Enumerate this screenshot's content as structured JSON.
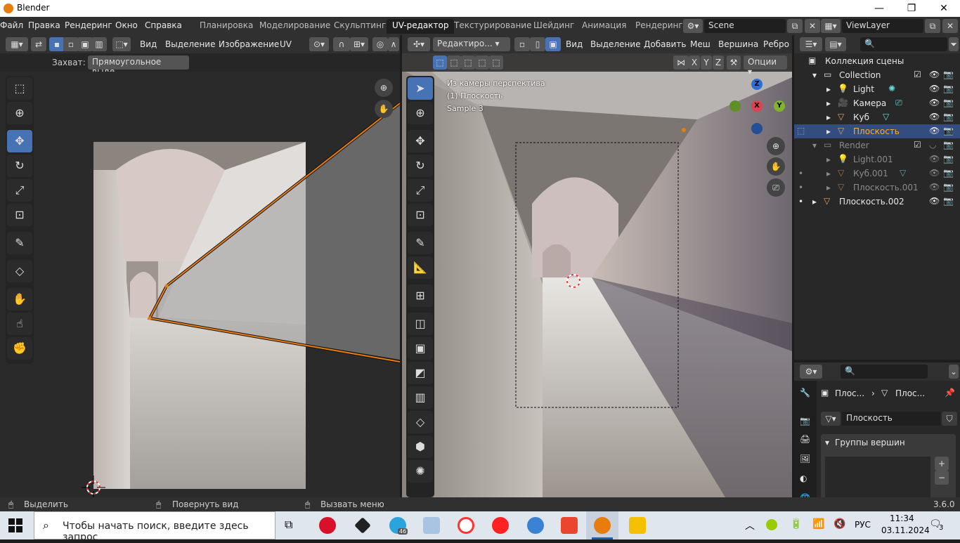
{
  "window": {
    "app_title": "Blender",
    "min": "—",
    "max": "❐",
    "close": "✕"
  },
  "menu": {
    "items": [
      "Файл",
      "Правка",
      "Рендеринг",
      "Окно",
      "Справка"
    ]
  },
  "workspaces": [
    "Планировка",
    "Моделирование",
    "Скульптинг",
    "UV-редактор",
    "Текстурирование",
    "Шейдинг",
    "Анимация",
    "Рендеринг"
  ],
  "active_workspace": "UV-редактор",
  "scene": {
    "name": "Scene",
    "view_layer": "ViewLayer"
  },
  "uv_editor": {
    "menus": [
      "Вид",
      "Выделение",
      "Изображение",
      "UV"
    ],
    "snap_label": "Захват:",
    "snap_value": "Прямоугольное выде..."
  },
  "viewport": {
    "mode": "Редактиро...",
    "menus": [
      "Вид",
      "Выделение",
      "Добавить",
      "Меш",
      "Вершина",
      "Ребро"
    ],
    "axes": [
      "X",
      "Y",
      "Z"
    ],
    "options": "Опции",
    "overlay_line1": "Из камеры перспектива",
    "overlay_line2": "(1) Плоскость",
    "overlay_line3": "Sample 3",
    "gizmo": {
      "x": "X",
      "y": "Y",
      "z": "Z"
    }
  },
  "outliner": {
    "scene_collection": "Коллекция сцены",
    "rows": [
      {
        "label": "Collection"
      },
      {
        "label": "Light"
      },
      {
        "label": "Камера"
      },
      {
        "label": "Куб"
      },
      {
        "label": "Плоскость"
      },
      {
        "label": "Render"
      },
      {
        "label": "Light.001"
      },
      {
        "label": "Куб.001"
      },
      {
        "label": "Плоскость.001"
      },
      {
        "label": "Плоскость.002"
      }
    ]
  },
  "properties": {
    "crumb1": "Плос...",
    "crumb_sep": "›",
    "crumb2": "Плос...",
    "mesh_name": "Плоскость",
    "panel_title": "Группы вершин",
    "add": "+",
    "remove": "−"
  },
  "statusbar": {
    "select": "Выделить",
    "rotate": "Повернуть вид",
    "menu": "Вызвать меню",
    "version": "3.6.0"
  },
  "taskbar": {
    "search_placeholder": "Чтобы начать поиск, введите здесь запрос",
    "lang": "РУС",
    "time": "11:34",
    "date": "03.11.2024",
    "telegram_badge": "46",
    "notif_count": "3"
  },
  "colors": {
    "accent": "#4772b3",
    "orange": "#e87d0d",
    "selected_row": "#334d80"
  }
}
